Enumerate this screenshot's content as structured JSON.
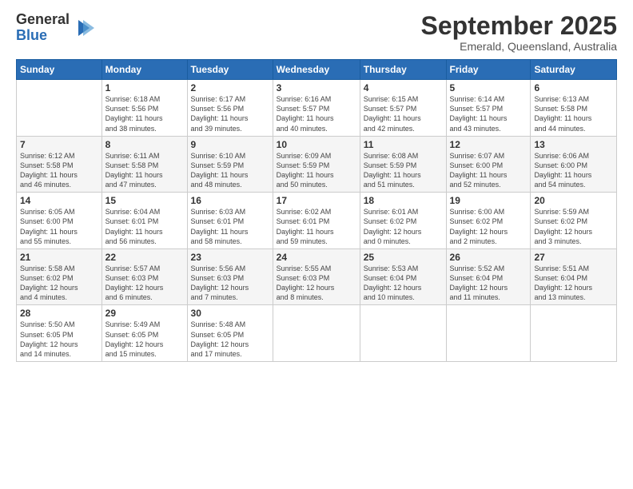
{
  "logo": {
    "general": "General",
    "blue": "Blue"
  },
  "title": "September 2025",
  "subtitle": "Emerald, Queensland, Australia",
  "headers": [
    "Sunday",
    "Monday",
    "Tuesday",
    "Wednesday",
    "Thursday",
    "Friday",
    "Saturday"
  ],
  "weeks": [
    [
      {
        "day": "",
        "info": ""
      },
      {
        "day": "1",
        "info": "Sunrise: 6:18 AM\nSunset: 5:56 PM\nDaylight: 11 hours\nand 38 minutes."
      },
      {
        "day": "2",
        "info": "Sunrise: 6:17 AM\nSunset: 5:56 PM\nDaylight: 11 hours\nand 39 minutes."
      },
      {
        "day": "3",
        "info": "Sunrise: 6:16 AM\nSunset: 5:57 PM\nDaylight: 11 hours\nand 40 minutes."
      },
      {
        "day": "4",
        "info": "Sunrise: 6:15 AM\nSunset: 5:57 PM\nDaylight: 11 hours\nand 42 minutes."
      },
      {
        "day": "5",
        "info": "Sunrise: 6:14 AM\nSunset: 5:57 PM\nDaylight: 11 hours\nand 43 minutes."
      },
      {
        "day": "6",
        "info": "Sunrise: 6:13 AM\nSunset: 5:58 PM\nDaylight: 11 hours\nand 44 minutes."
      }
    ],
    [
      {
        "day": "7",
        "info": "Sunrise: 6:12 AM\nSunset: 5:58 PM\nDaylight: 11 hours\nand 46 minutes."
      },
      {
        "day": "8",
        "info": "Sunrise: 6:11 AM\nSunset: 5:58 PM\nDaylight: 11 hours\nand 47 minutes."
      },
      {
        "day": "9",
        "info": "Sunrise: 6:10 AM\nSunset: 5:59 PM\nDaylight: 11 hours\nand 48 minutes."
      },
      {
        "day": "10",
        "info": "Sunrise: 6:09 AM\nSunset: 5:59 PM\nDaylight: 11 hours\nand 50 minutes."
      },
      {
        "day": "11",
        "info": "Sunrise: 6:08 AM\nSunset: 5:59 PM\nDaylight: 11 hours\nand 51 minutes."
      },
      {
        "day": "12",
        "info": "Sunrise: 6:07 AM\nSunset: 6:00 PM\nDaylight: 11 hours\nand 52 minutes."
      },
      {
        "day": "13",
        "info": "Sunrise: 6:06 AM\nSunset: 6:00 PM\nDaylight: 11 hours\nand 54 minutes."
      }
    ],
    [
      {
        "day": "14",
        "info": "Sunrise: 6:05 AM\nSunset: 6:00 PM\nDaylight: 11 hours\nand 55 minutes."
      },
      {
        "day": "15",
        "info": "Sunrise: 6:04 AM\nSunset: 6:01 PM\nDaylight: 11 hours\nand 56 minutes."
      },
      {
        "day": "16",
        "info": "Sunrise: 6:03 AM\nSunset: 6:01 PM\nDaylight: 11 hours\nand 58 minutes."
      },
      {
        "day": "17",
        "info": "Sunrise: 6:02 AM\nSunset: 6:01 PM\nDaylight: 11 hours\nand 59 minutes."
      },
      {
        "day": "18",
        "info": "Sunrise: 6:01 AM\nSunset: 6:02 PM\nDaylight: 12 hours\nand 0 minutes."
      },
      {
        "day": "19",
        "info": "Sunrise: 6:00 AM\nSunset: 6:02 PM\nDaylight: 12 hours\nand 2 minutes."
      },
      {
        "day": "20",
        "info": "Sunrise: 5:59 AM\nSunset: 6:02 PM\nDaylight: 12 hours\nand 3 minutes."
      }
    ],
    [
      {
        "day": "21",
        "info": "Sunrise: 5:58 AM\nSunset: 6:02 PM\nDaylight: 12 hours\nand 4 minutes."
      },
      {
        "day": "22",
        "info": "Sunrise: 5:57 AM\nSunset: 6:03 PM\nDaylight: 12 hours\nand 6 minutes."
      },
      {
        "day": "23",
        "info": "Sunrise: 5:56 AM\nSunset: 6:03 PM\nDaylight: 12 hours\nand 7 minutes."
      },
      {
        "day": "24",
        "info": "Sunrise: 5:55 AM\nSunset: 6:03 PM\nDaylight: 12 hours\nand 8 minutes."
      },
      {
        "day": "25",
        "info": "Sunrise: 5:53 AM\nSunset: 6:04 PM\nDaylight: 12 hours\nand 10 minutes."
      },
      {
        "day": "26",
        "info": "Sunrise: 5:52 AM\nSunset: 6:04 PM\nDaylight: 12 hours\nand 11 minutes."
      },
      {
        "day": "27",
        "info": "Sunrise: 5:51 AM\nSunset: 6:04 PM\nDaylight: 12 hours\nand 13 minutes."
      }
    ],
    [
      {
        "day": "28",
        "info": "Sunrise: 5:50 AM\nSunset: 6:05 PM\nDaylight: 12 hours\nand 14 minutes."
      },
      {
        "day": "29",
        "info": "Sunrise: 5:49 AM\nSunset: 6:05 PM\nDaylight: 12 hours\nand 15 minutes."
      },
      {
        "day": "30",
        "info": "Sunrise: 5:48 AM\nSunset: 6:05 PM\nDaylight: 12 hours\nand 17 minutes."
      },
      {
        "day": "",
        "info": ""
      },
      {
        "day": "",
        "info": ""
      },
      {
        "day": "",
        "info": ""
      },
      {
        "day": "",
        "info": ""
      }
    ]
  ]
}
